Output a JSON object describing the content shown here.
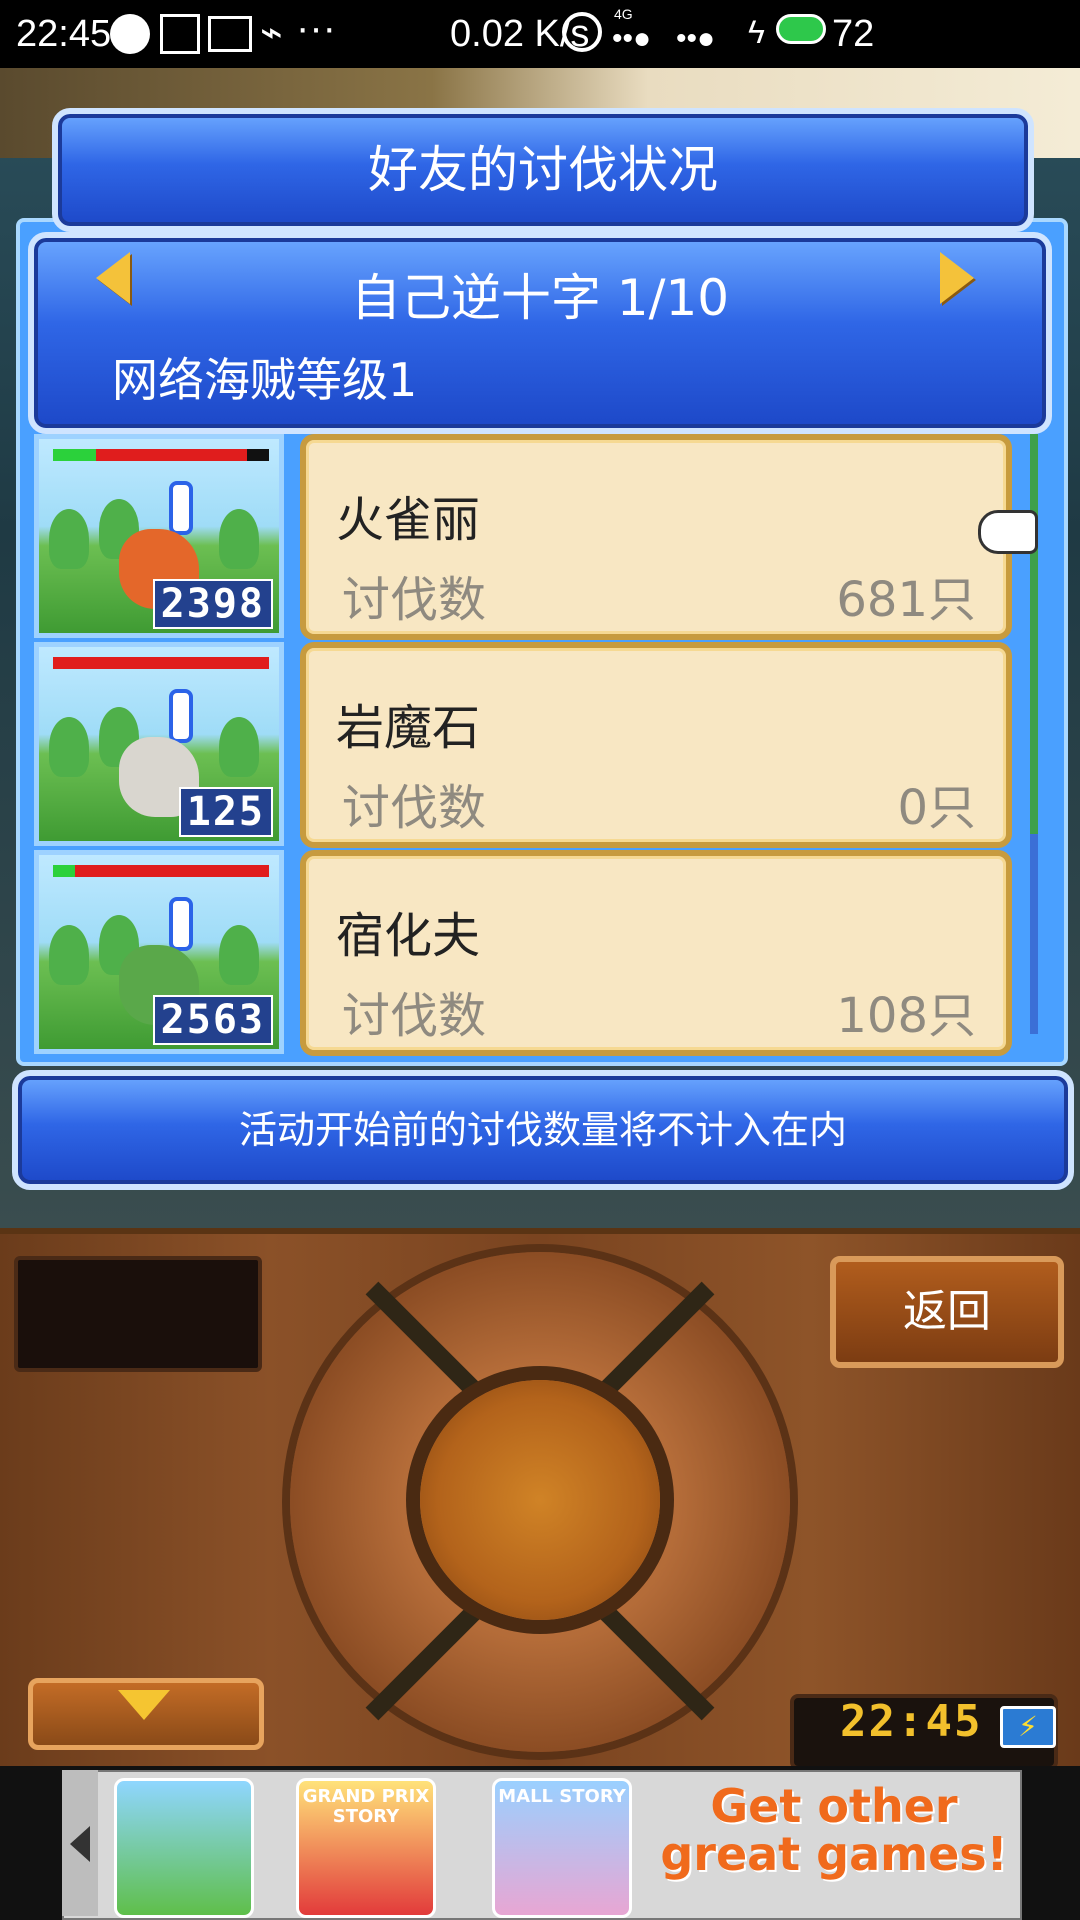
{
  "status_bar": {
    "time": "22:45",
    "speed": "0.02 K/s",
    "battery": "72",
    "network": "4G"
  },
  "dialog": {
    "title": "好友的讨伐状况",
    "header": {
      "title": "自己逆十字 1/10",
      "subtitle": "网络海贼等级1"
    },
    "rows": [
      {
        "name": "火雀丽",
        "label": "讨伐数",
        "value": "681只",
        "count": "2398",
        "hp_green": 0.2,
        "hp_red": 0.7
      },
      {
        "name": "岩魔石",
        "label": "讨伐数",
        "value": "0只",
        "count": "125",
        "hp_green": 0.0,
        "hp_red": 1.0
      },
      {
        "name": "宿化夫",
        "label": "讨伐数",
        "value": "108只",
        "count": "2563",
        "hp_green": 0.1,
        "hp_red": 0.9
      }
    ],
    "notice": "活动开始前的讨伐数量将不计入在内"
  },
  "controls": {
    "back_label": "返回",
    "clock": "22:45"
  },
  "ad": {
    "tiles": [
      "",
      "GRAND PRIX STORY",
      "MALL STORY"
    ],
    "cta": "Get other great games!"
  },
  "colors": {
    "panel_blue": "#2f66e6",
    "card_cream": "#f8e7c3",
    "wood_brown": "#8b5128",
    "accent_gold": "#f4c23a"
  }
}
